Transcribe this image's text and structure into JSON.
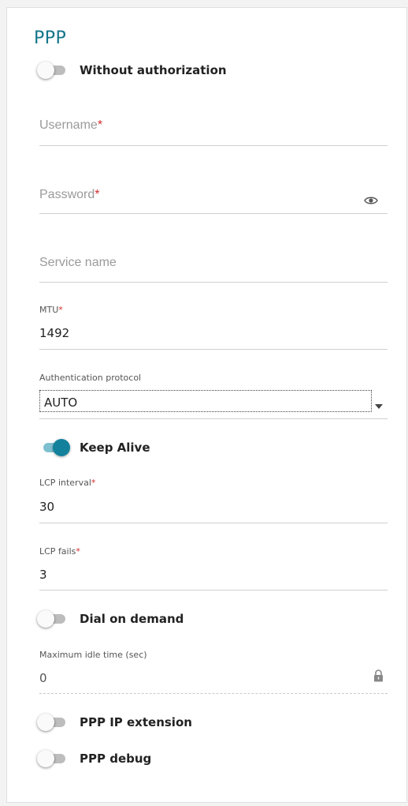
{
  "section": {
    "title": "PPP"
  },
  "without_auth": {
    "label": "Without authorization",
    "enabled": false
  },
  "username": {
    "label": "Username",
    "required_mark": "*",
    "value": ""
  },
  "password": {
    "label": "Password",
    "required_mark": "*",
    "value": "",
    "icon": "eye-icon"
  },
  "service_name": {
    "label": "Service name",
    "value": ""
  },
  "mtu": {
    "label": "MTU",
    "required_mark": "*",
    "value": "1492"
  },
  "auth_protocol": {
    "label": "Authentication protocol",
    "value": "AUTO",
    "icon": "dropdown-arrow-icon"
  },
  "keep_alive": {
    "label": "Keep Alive",
    "enabled": true
  },
  "lcp_interval": {
    "label": "LCP interval",
    "required_mark": "*",
    "value": "30"
  },
  "lcp_fails": {
    "label": "LCP fails",
    "required_mark": "*",
    "value": "3"
  },
  "dial_on_demand": {
    "label": "Dial on demand",
    "enabled": false
  },
  "max_idle": {
    "label": "Maximum idle time (sec)",
    "value": "0",
    "icon": "lock-icon"
  },
  "ppp_ip_extension": {
    "label": "PPP IP extension",
    "enabled": false
  },
  "ppp_debug": {
    "label": "PPP debug",
    "enabled": false
  },
  "colors": {
    "accent": "#13758a",
    "toggle_on": "#13819c",
    "required": "#d32f2f"
  }
}
